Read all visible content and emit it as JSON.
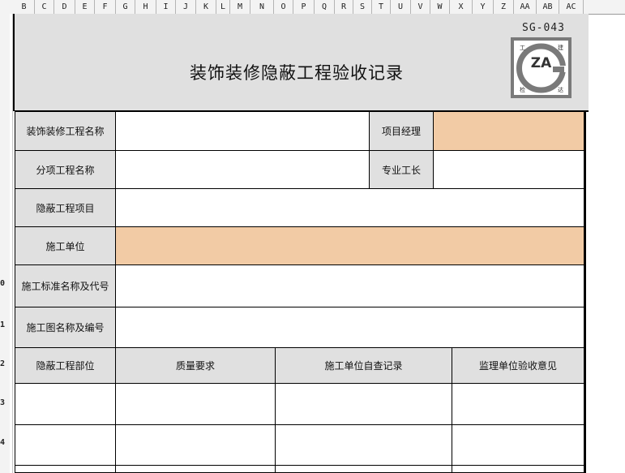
{
  "columns": [
    "B",
    "C",
    "D",
    "E",
    "F",
    "G",
    "H",
    "I",
    "J",
    "K",
    "L",
    "M",
    "N",
    "O",
    "P",
    "Q",
    "R",
    "S",
    "T",
    "U",
    "V",
    "W",
    "X",
    "Y",
    "Z",
    "AA",
    "AB",
    "AC"
  ],
  "rows": [
    "0",
    "1",
    "2",
    "3",
    "4"
  ],
  "document": {
    "code": "SG-043",
    "title": "装饰装修隐蔽工程验收记录",
    "logo": {
      "letters": "ZA",
      "corner_chars": [
        "工",
        "建",
        "检",
        "达"
      ]
    }
  },
  "form": {
    "project_name_label": "装饰装修工程名称",
    "project_manager_label": "项目经理",
    "sub_project_label": "分项工程名称",
    "foreman_label": "专业工长",
    "hidden_item_label": "隐蔽工程项目",
    "construction_unit_label": "施工单位",
    "standard_label": "施工标准名称及代号",
    "drawing_label": "施工图名称及编号",
    "table_headers": [
      "隐蔽工程部位",
      "质量要求",
      "施工单位自查记录",
      "监理单位验收意见"
    ]
  },
  "colors": {
    "label_bg": "#e0e0e0",
    "highlight": "#f2cba5"
  }
}
